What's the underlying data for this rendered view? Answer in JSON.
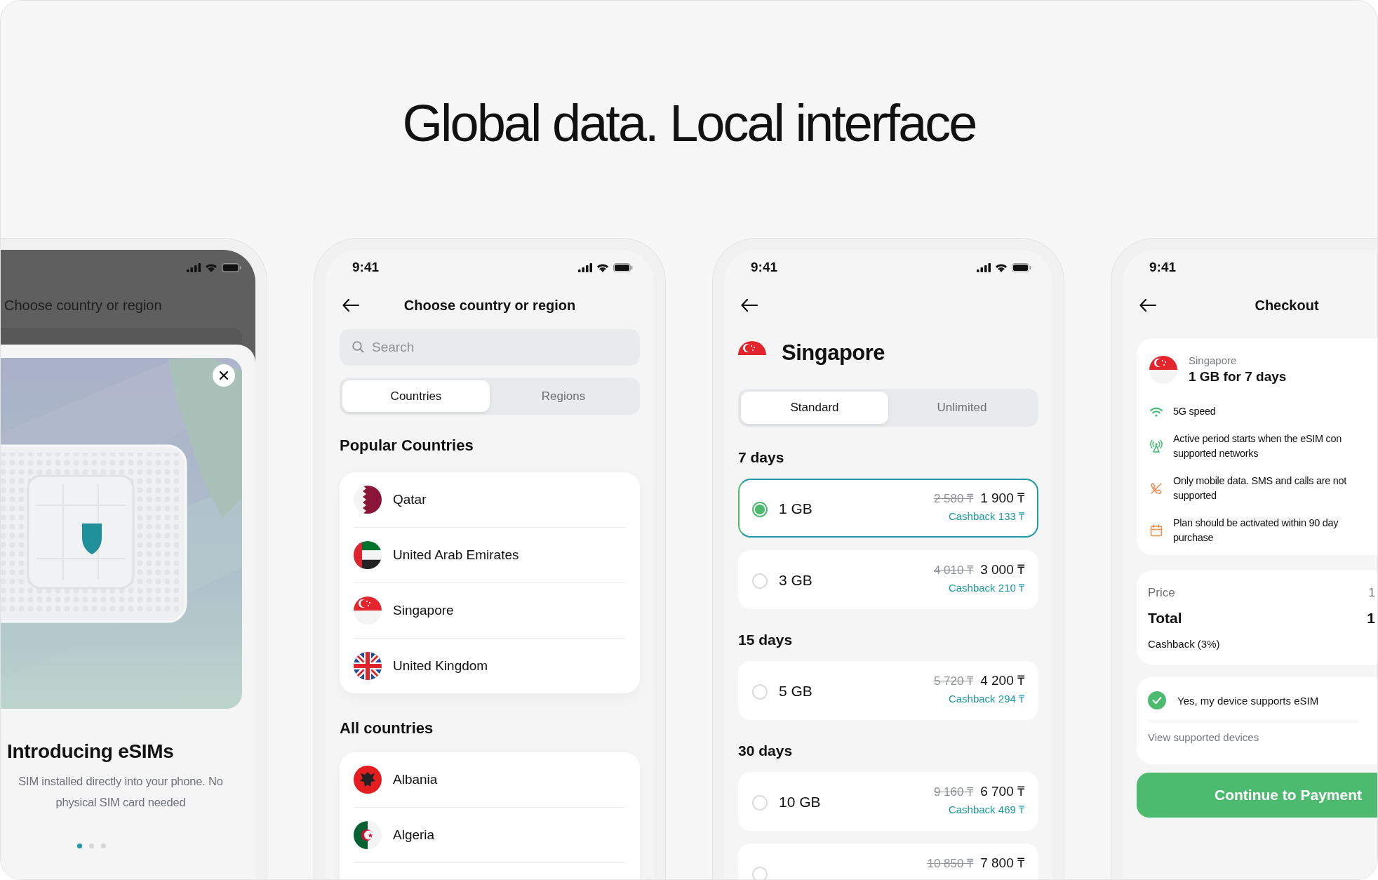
{
  "headline": "Global data. Local interface",
  "intro_screen": {
    "header_title": "Choose country or region",
    "sheet": {
      "title": "Introducing eSIMs",
      "description_lines": [
        "SIM installed directly into your phone. No",
        "physical SIM card needed"
      ],
      "page_dots": [
        {
          "selected": true
        },
        {
          "selected": false
        },
        {
          "selected": false
        }
      ]
    }
  },
  "countries_screen": {
    "time": "9:41",
    "title": "Choose country or region",
    "search": {
      "placeholder": "Search"
    },
    "tabs": [
      {
        "label": "Countries",
        "selected": true
      },
      {
        "label": "Regions",
        "selected": false
      }
    ],
    "popular_heading": "Popular Countries",
    "popular": [
      {
        "name": "Qatar",
        "kind": "qatar"
      },
      {
        "name": "United Arab Emirates",
        "kind": "uae"
      },
      {
        "name": "Singapore",
        "kind": "singapore"
      },
      {
        "name": "United Kingdom",
        "kind": "uk"
      }
    ],
    "all_heading": "All countries",
    "all": [
      {
        "name": "Albania",
        "kind": "albania"
      },
      {
        "name": "Algeria",
        "kind": "algeria"
      }
    ]
  },
  "plans_screen": {
    "time": "9:41",
    "country": {
      "name": "Singapore",
      "kind": "singapore"
    },
    "tabs": [
      {
        "label": "Standard",
        "selected": true
      },
      {
        "label": "Unlimited",
        "selected": false
      }
    ],
    "groups": [
      {
        "heading": "7 days",
        "plans": [
          {
            "data": "1 GB",
            "old_price": "2 580 ₸",
            "price": "1 900 ₸",
            "cashback": "Cashback 133 ₸",
            "selected": true
          },
          {
            "data": "3 GB",
            "old_price": "4 010 ₸",
            "price": "3 000 ₸",
            "cashback": "Cashback 210 ₸",
            "selected": false
          }
        ]
      },
      {
        "heading": "15 days",
        "plans": [
          {
            "data": "5 GB",
            "old_price": "5 720 ₸",
            "price": "4 200 ₸",
            "cashback": "Cashback 294 ₸",
            "selected": false
          }
        ]
      },
      {
        "heading": "30 days",
        "plans": [
          {
            "data": "10 GB",
            "old_price": "9 160 ₸",
            "price": "6 700 ₸",
            "cashback": "Cashback 469 ₸",
            "selected": false
          },
          {
            "old_price": "10 850 ₸",
            "price": "7 800 ₸",
            "selected": false
          }
        ]
      }
    ]
  },
  "checkout_screen": {
    "time": "9:41",
    "title": "Checkout",
    "country": {
      "name": "Singapore",
      "kind": "singapore"
    },
    "plan": "1 GB for 7 days",
    "features": [
      {
        "kind": "wifi",
        "lines": [
          "5G speed"
        ]
      },
      {
        "kind": "antenna",
        "lines": [
          "Active period starts when the eSIM con",
          "supported networks"
        ]
      },
      {
        "kind": "no-calls",
        "lines": [
          "Only mobile data. SMS and calls are not",
          "supported"
        ]
      },
      {
        "kind": "calendar",
        "lines": [
          "Plan should be activated within 90 day",
          "purchase"
        ]
      }
    ],
    "price_label": "Price",
    "price_value": "1",
    "total_label": "Total",
    "total_value": "1",
    "cashback_label": "Cashback (3%)",
    "confirm": {
      "label": "Yes, my device supports eSIM",
      "checked": true
    },
    "supported_link": "View supported devices",
    "button": "Continue to Payment"
  }
}
